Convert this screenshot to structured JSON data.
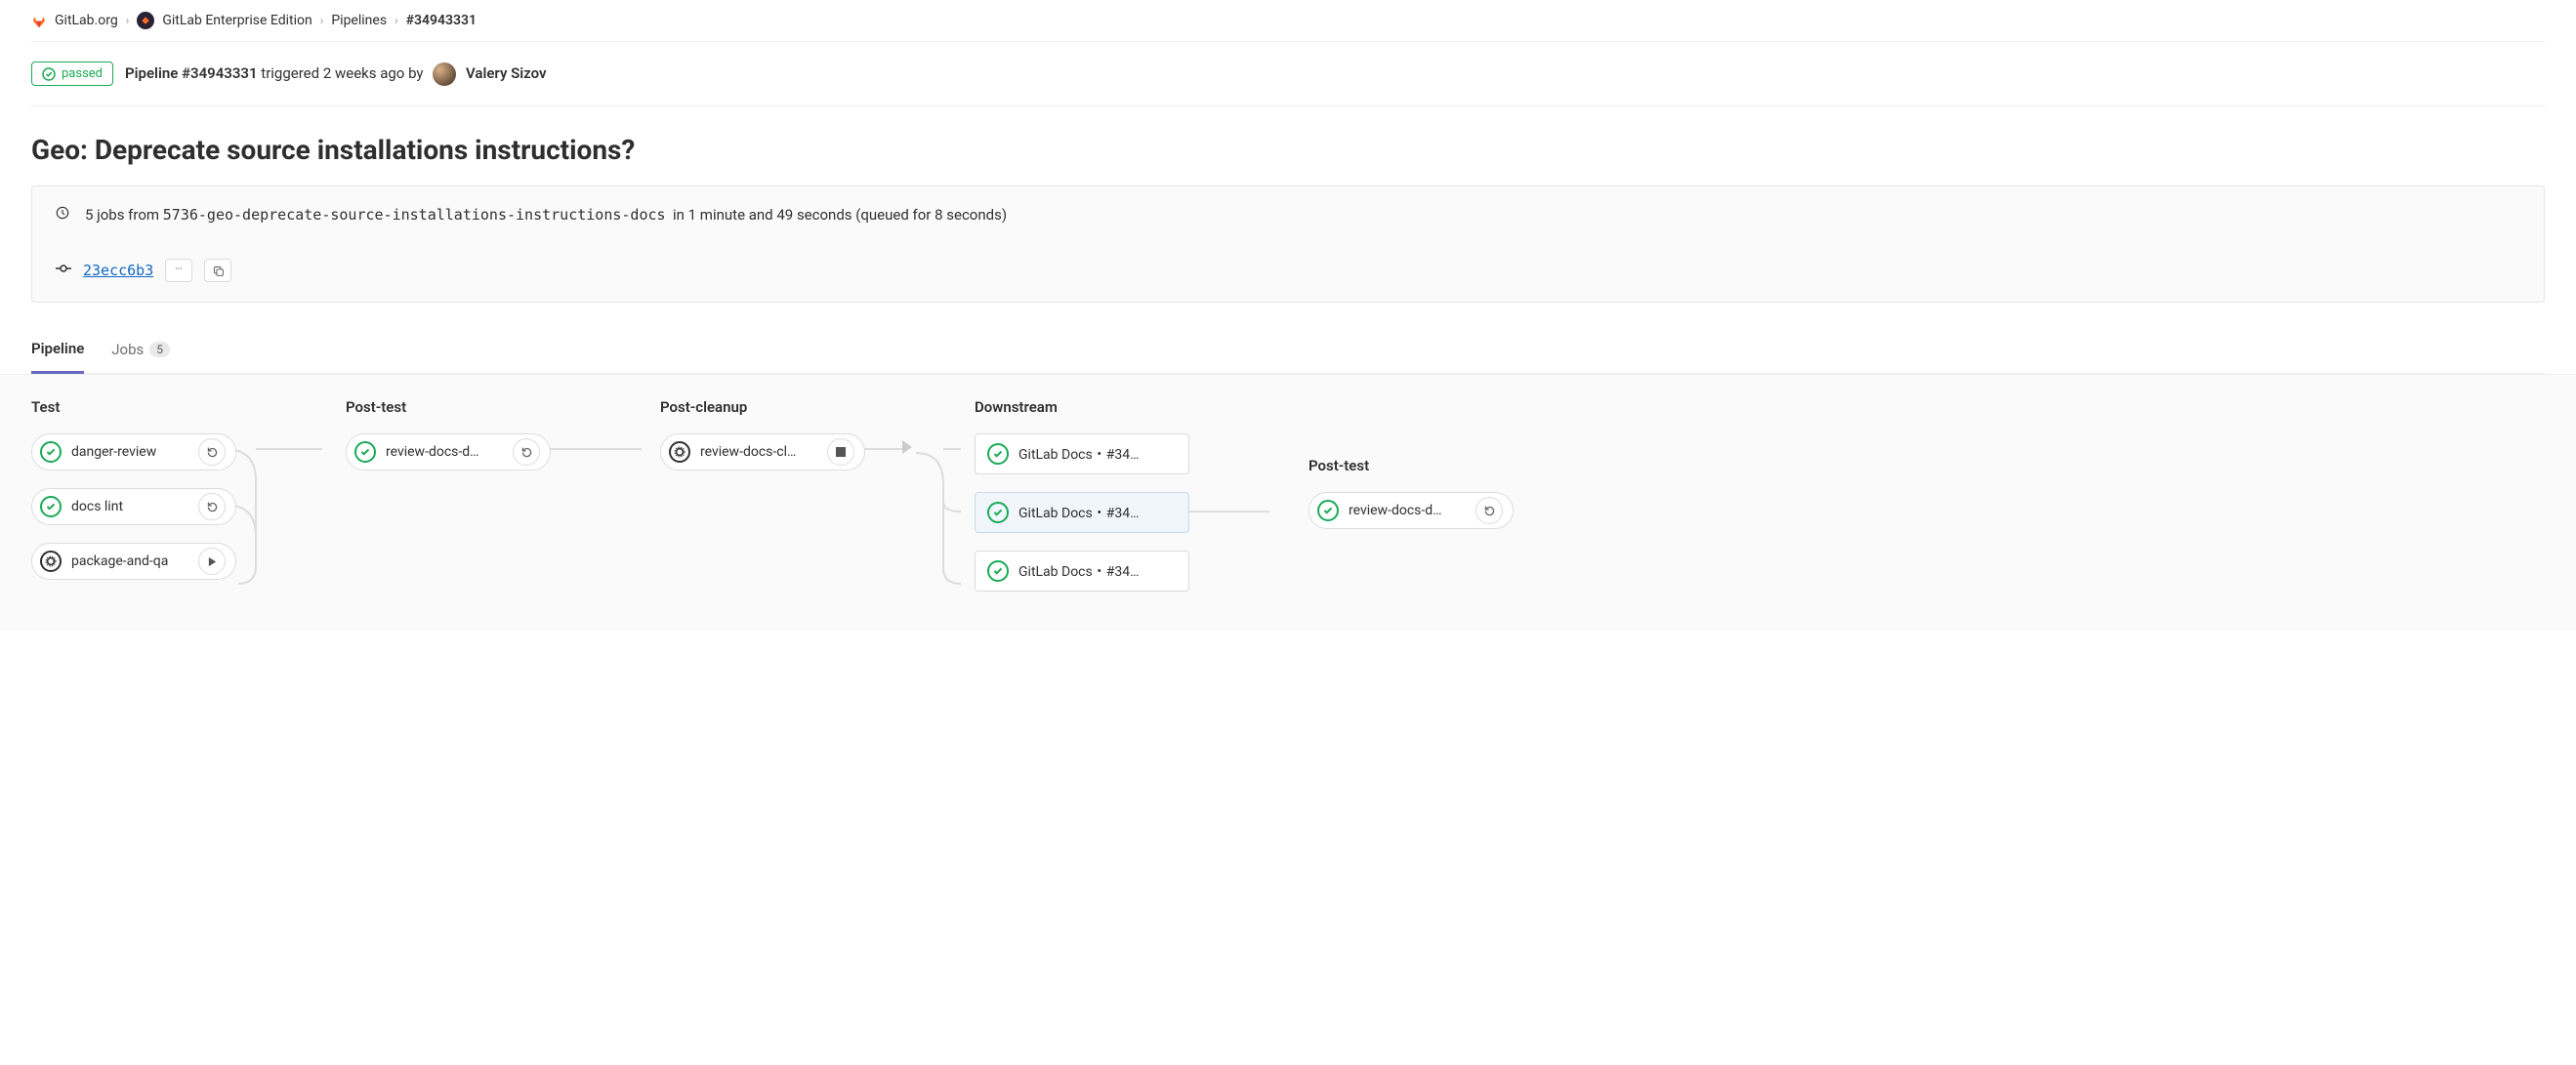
{
  "breadcrumb": {
    "org": "GitLab.org",
    "project": "GitLab Enterprise Edition",
    "section": "Pipelines",
    "id": "#34943331"
  },
  "status": {
    "label": "passed"
  },
  "trigger": {
    "prefix": "Pipeline",
    "id": "#34943331",
    "mid": "triggered 2 weeks ago by",
    "user": "Valery Sizov"
  },
  "title": "Geo: Deprecate source installations instructions?",
  "info": {
    "jobs_count": "5 jobs from",
    "branch": "5736-geo-deprecate-source-installations-instructions-docs",
    "timing": "in 1 minute and 49 seconds (queued for 8 seconds)"
  },
  "commit": {
    "hash": "23ecc6b3"
  },
  "tabs": {
    "pipeline": "Pipeline",
    "jobs": "Jobs",
    "jobs_count": "5"
  },
  "stages": {
    "test": {
      "title": "Test",
      "jobs": [
        {
          "label": "danger-review",
          "status": "success",
          "action": "retry"
        },
        {
          "label": "docs lint",
          "status": "success",
          "action": "retry"
        },
        {
          "label": "package-and-qa",
          "status": "manual",
          "action": "play"
        }
      ]
    },
    "post_test": {
      "title": "Post-test",
      "jobs": [
        {
          "label": "review-docs-d…",
          "status": "success",
          "action": "retry"
        }
      ]
    },
    "post_cleanup": {
      "title": "Post-cleanup",
      "jobs": [
        {
          "label": "review-docs-cl…",
          "status": "manual",
          "action": "stop"
        }
      ]
    },
    "downstream": {
      "title": "Downstream",
      "jobs": [
        {
          "label": "GitLab Docs・#34…",
          "status": "success"
        },
        {
          "label": "GitLab Docs・#34…",
          "status": "success",
          "selected": true
        },
        {
          "label": "GitLab Docs・#34…",
          "status": "success"
        }
      ],
      "sub": {
        "title": "Post-test",
        "jobs": [
          {
            "label": "review-docs-d…",
            "status": "success",
            "action": "retry"
          }
        ]
      }
    }
  }
}
